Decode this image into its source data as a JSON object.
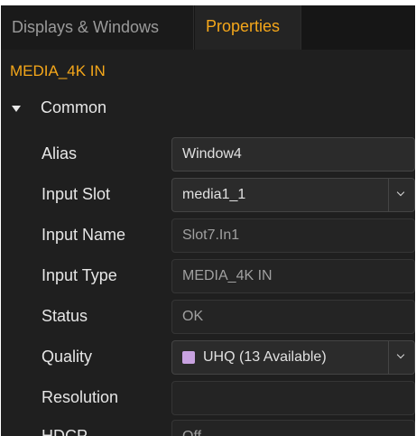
{
  "tabs": {
    "displays_windows": "Displays & Windows",
    "properties": "Properties"
  },
  "object_title": "MEDIA_4K IN",
  "section": {
    "label": "Common",
    "expanded": true
  },
  "fields": {
    "alias": {
      "label": "Alias",
      "value": "Window4"
    },
    "input_slot": {
      "label": "Input Slot",
      "value": "media1_1"
    },
    "input_name": {
      "label": "Input Name",
      "value": "Slot7.In1"
    },
    "input_type": {
      "label": "Input Type",
      "value": "MEDIA_4K IN"
    },
    "status": {
      "label": "Status",
      "value": "OK"
    },
    "quality": {
      "label": "Quality",
      "value": "UHQ (13 Available)",
      "swatch_color": "#c8a2e0"
    },
    "resolution": {
      "label": "Resolution",
      "value": ""
    },
    "hdcp": {
      "label": "HDCP",
      "value": "Off"
    }
  },
  "colors": {
    "accent": "#f5a71a",
    "panel_bg": "#1f1f1f"
  },
  "icons": {
    "section_toggle": "caret-down-icon",
    "dropdown": "chevron-down-icon"
  }
}
